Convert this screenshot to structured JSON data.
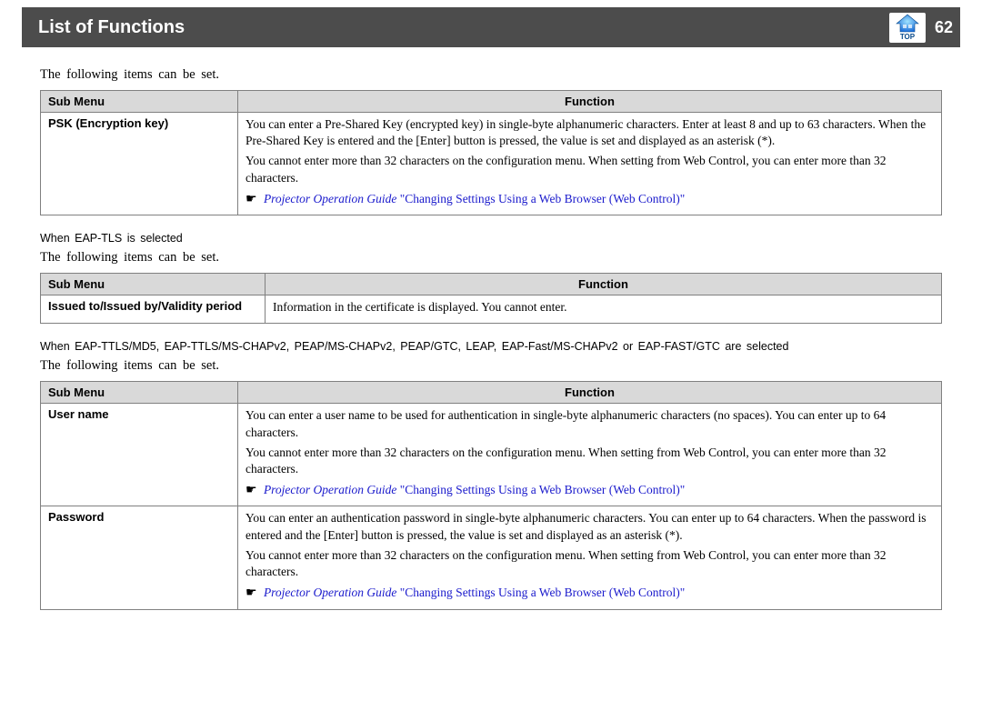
{
  "header": {
    "title": "List of Functions",
    "page_number": "62",
    "top_label": "TOP"
  },
  "section1": {
    "intro": "The following items can be set.",
    "col_sub": "Sub Menu",
    "col_func": "Function",
    "row1": {
      "label": "PSK (Encryption key)",
      "p1": "You can enter a Pre-Shared Key (encrypted key) in single-byte alphanumeric characters. Enter at least 8 and up to 63 characters. When the Pre-Shared Key is entered and the [Enter] button is pressed, the value is set and displayed as an asterisk (*).",
      "p2": "You cannot enter more than 32 characters on the configuration menu. When setting from Web Control, you can enter more than 32 characters.",
      "link_guide": "Projector Operation Guide",
      "link_topic": " \"Changing Settings Using a Web Browser (Web Control)\""
    }
  },
  "section2": {
    "heading": "When EAP-TLS is selected",
    "intro": "The following items can be set.",
    "col_sub": "Sub Menu",
    "col_func": "Function",
    "row1": {
      "label": "Issued to/Issued by/Validity period",
      "p1": "Information in the certificate is displayed. You cannot enter."
    }
  },
  "section3": {
    "heading": "When EAP-TTLS/MD5, EAP-TTLS/MS-CHAPv2, PEAP/MS-CHAPv2, PEAP/GTC, LEAP, EAP-Fast/MS-CHAPv2 or EAP-FAST/GTC are selected",
    "intro": "The following items can be set.",
    "col_sub": "Sub Menu",
    "col_func": "Function",
    "row1": {
      "label": "User name",
      "p1": "You can enter a user name to be used for authentication in single-byte alphanumeric characters (no spaces). You can enter up to 64 characters.",
      "p2": "You cannot enter more than 32 characters on the configuration menu. When setting from Web Control, you can enter more than 32 characters.",
      "link_guide": "Projector Operation Guide",
      "link_topic": " \"Changing Settings Using a Web Browser (Web Control)\""
    },
    "row2": {
      "label": "Password",
      "p1": "You can enter an authentication password in single-byte alphanumeric characters. You can enter up to 64 characters. When the password is entered and the [Enter] button is pressed, the value is set and displayed as an asterisk (*).",
      "p2": "You cannot enter more than 32 characters on the configuration menu. When setting from Web Control, you can enter more than 32 characters.",
      "link_guide": "Projector Operation Guide",
      "link_topic": " \"Changing Settings Using a Web Browser (Web Control)\""
    }
  }
}
